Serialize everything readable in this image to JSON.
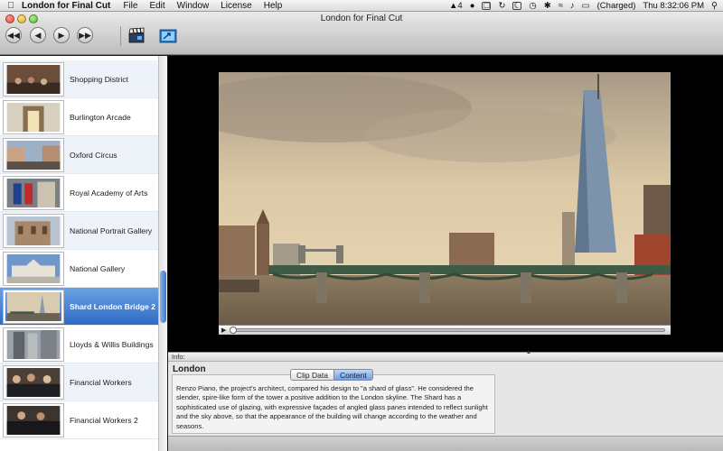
{
  "menubar": {
    "apple": "",
    "app_name": "London for Final Cut",
    "menus": [
      "File",
      "Edit",
      "Window",
      "License",
      "Help"
    ],
    "status": {
      "adobe_badge": "4",
      "battery": "(Charged)",
      "clock": "Thu 8:32:06 PM",
      "search_icon": "search-icon"
    }
  },
  "window": {
    "title": "London for Final Cut",
    "toolbar": {
      "rewind": "◀◀",
      "back": "◀",
      "play": "▶",
      "forward": "▶▶"
    }
  },
  "sidebar": {
    "items": [
      {
        "label": "Shopping District"
      },
      {
        "label": "Burlington Arcade"
      },
      {
        "label": "Oxford Circus"
      },
      {
        "label": "Royal Academy of Arts"
      },
      {
        "label": "National Portrait Gallery"
      },
      {
        "label": "National Gallery"
      },
      {
        "label": "Shard London Bridge 2",
        "selected": true
      },
      {
        "label": "Lloyds & Willis Buildings"
      },
      {
        "label": "Financial Workers"
      },
      {
        "label": "Financial Workers 2"
      }
    ]
  },
  "info": {
    "header": "Info:",
    "title": "London",
    "tabs": [
      "Clip Data",
      "Content"
    ],
    "active_tab": "Content",
    "content_text": "Renzo Piano, the project's architect, compared his design to \"a shard of glass\". He considered the slender, spire-like form of the tower a positive addition to the London skyline. The Shard has a sophisticated use of glazing, with expressive façades of angled glass panes intended to reflect sunlight and the sky above, so that the appearance of the building will change according to the weather and seasons."
  },
  "colors": {
    "selection": "#3f7bd0",
    "player_bg": "#000000",
    "sky": "#d8c7a6"
  }
}
